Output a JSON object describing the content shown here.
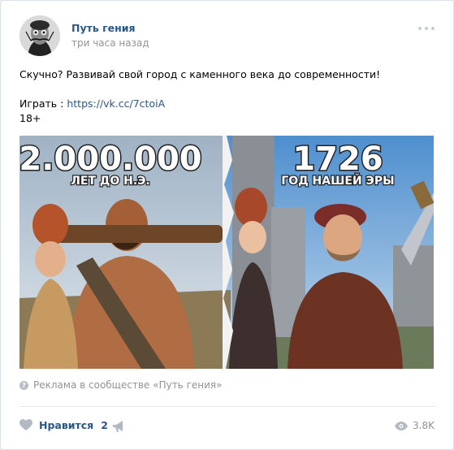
{
  "post": {
    "author": "Путь гения",
    "time": "три часа назад",
    "text_line1": "Скучно? Развивай свой город с каменного века до современности!",
    "play_label": "Играть :",
    "play_link": "https://vk.cc/7ctoiA",
    "age": "18+"
  },
  "image": {
    "left_number": "2.000.000",
    "left_caption": "ЛЕТ ДО Н.Э.",
    "right_number": "1726",
    "right_caption": "ГОД НАШЕЙ ЭРЫ"
  },
  "ad": {
    "icon": "info-icon",
    "text": "Реклама в сообществе «Путь гения»"
  },
  "footer": {
    "like_label": "Нравится",
    "like_count": "2",
    "views": "3.8K"
  },
  "colors": {
    "link": "#2a5885",
    "muted": "#939393",
    "divider": "#e7e8ec"
  }
}
